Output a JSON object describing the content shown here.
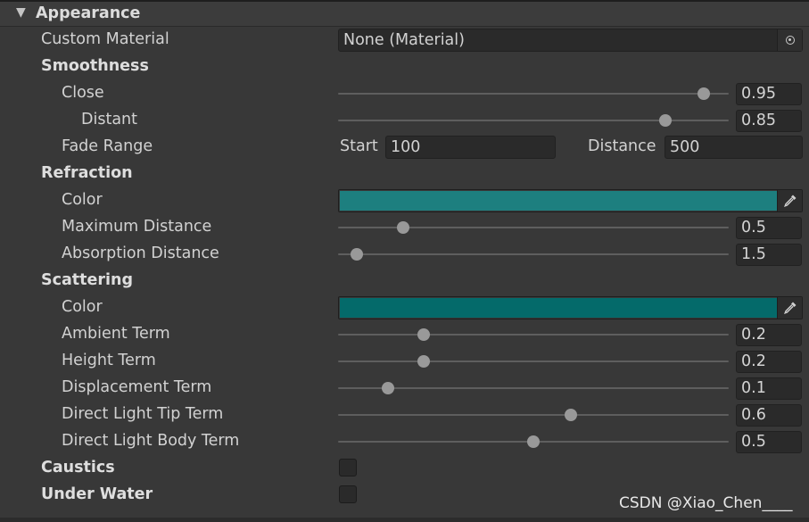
{
  "header": {
    "title": "Appearance",
    "foldout_icon": "triangle-down"
  },
  "custom_material": {
    "label": "Custom Material",
    "value": "None (Material)",
    "picker_icon": "object-picker"
  },
  "smoothness": {
    "label": "Smoothness",
    "close": {
      "label": "Close",
      "value": "0.95",
      "level": 0.95
    },
    "distant": {
      "label": "Distant",
      "value": "0.85",
      "level": 0.85
    },
    "fade_range": {
      "label": "Fade Range",
      "start_label": "Start",
      "start_value": "100",
      "distance_label": "Distance",
      "distance_value": "500"
    }
  },
  "refraction": {
    "label": "Refraction",
    "color": {
      "label": "Color",
      "hex": "#1d7f7f"
    },
    "maximum_distance": {
      "label": "Maximum Distance",
      "value": "0.5",
      "level": 0.155
    },
    "absorption_distance": {
      "label": "Absorption Distance",
      "value": "1.5",
      "level": 0.032
    }
  },
  "scattering": {
    "label": "Scattering",
    "color": {
      "label": "Color",
      "hex": "#046a6a"
    },
    "ambient_term": {
      "label": "Ambient Term",
      "value": "0.2",
      "level": 0.21
    },
    "height_term": {
      "label": "Height Term",
      "value": "0.2",
      "level": 0.21
    },
    "displacement_term": {
      "label": "Displacement Term",
      "value": "0.1",
      "level": 0.115
    },
    "direct_light_tip_term": {
      "label": "Direct Light Tip Term",
      "value": "0.6",
      "level": 0.6
    },
    "direct_light_body_term": {
      "label": "Direct Light Body Term",
      "value": "0.5",
      "level": 0.5
    }
  },
  "caustics": {
    "label": "Caustics",
    "checked": false
  },
  "under_water": {
    "label": "Under Water",
    "checked": false
  },
  "watermark": "CSDN @Xiao_Chen____"
}
